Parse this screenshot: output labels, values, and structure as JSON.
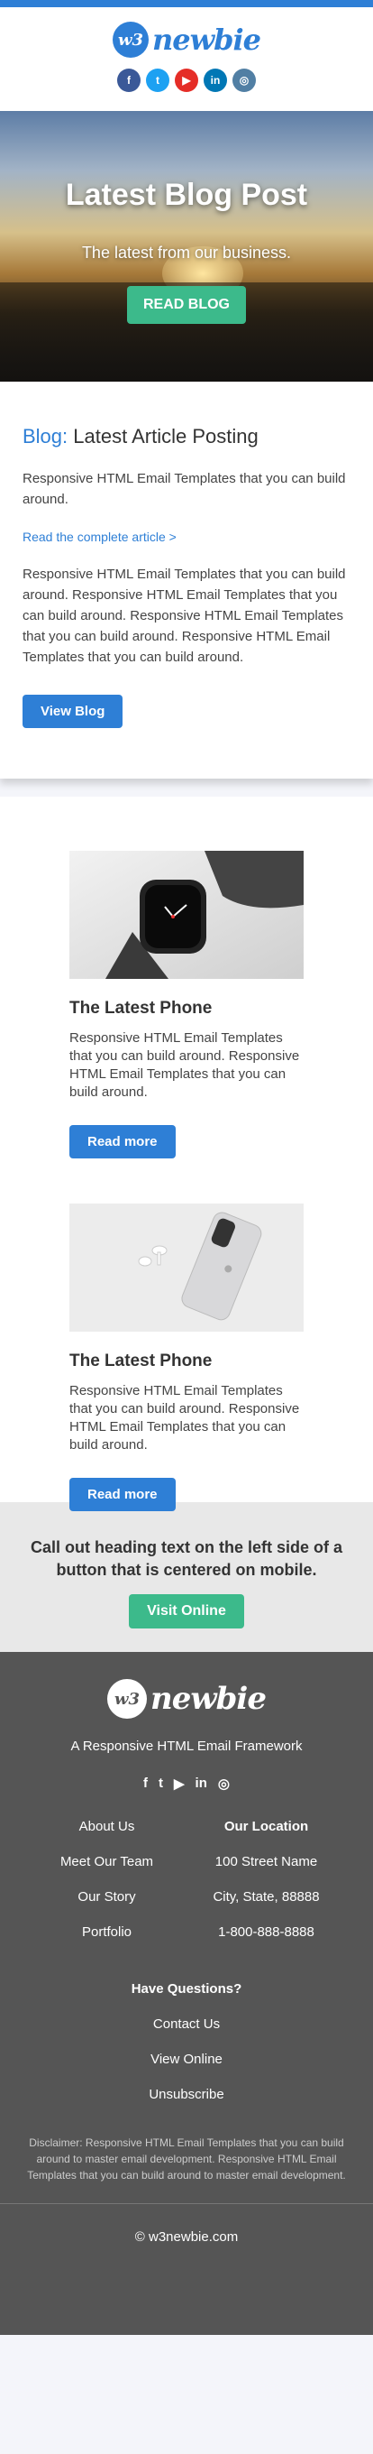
{
  "brand": {
    "badge": "w3",
    "name": "newbie"
  },
  "header_socials": [
    {
      "icon": "facebook-icon",
      "glyph": "f",
      "color": "#3b5998"
    },
    {
      "icon": "twitter-icon",
      "glyph": "t",
      "color": "#1da1f2"
    },
    {
      "icon": "youtube-icon",
      "glyph": "▶",
      "color": "#e52d27"
    },
    {
      "icon": "linkedin-icon",
      "glyph": "in",
      "color": "#0077b5"
    },
    {
      "icon": "instagram-icon",
      "glyph": "◎",
      "color": "#517fa4"
    }
  ],
  "hero": {
    "title": "Latest Blog Post",
    "subtitle": "The latest from our business.",
    "button": "READ BLOG"
  },
  "article": {
    "heading_prefix": "Blog:",
    "heading_rest": " Latest Article Posting",
    "intro": "Responsive HTML Email Templates that you can build around.",
    "link": "Read the complete article >",
    "body": "Responsive HTML Email Templates that you can build around. Responsive HTML Email Templates that you can build around. Responsive HTML Email Templates that you can build around. Responsive HTML Email Templates that you can build around.",
    "button": "View Blog"
  },
  "products": [
    {
      "title": "The Latest Phone",
      "text": "Responsive HTML Email Templates that you can build around. Responsive HTML Email Templates that you can build around.",
      "button": "Read more"
    },
    {
      "title": "The Latest Phone",
      "text": "Responsive HTML Email Templates that you can build around. Responsive HTML Email Templates that you can build around.",
      "button": "Read more"
    }
  ],
  "callout": {
    "heading": "Call out heading text on the left side of a button that is centered on mobile.",
    "button": "Visit Online"
  },
  "footer": {
    "tagline": "A Responsive HTML Email Framework",
    "socials": [
      {
        "icon": "facebook-icon",
        "glyph": "f"
      },
      {
        "icon": "twitter-icon",
        "glyph": "t"
      },
      {
        "icon": "youtube-icon",
        "glyph": "▶"
      },
      {
        "icon": "linkedin-icon",
        "glyph": "in"
      },
      {
        "icon": "instagram-icon",
        "glyph": "◎"
      }
    ],
    "links": [
      "About Us",
      "Meet Our Team",
      "Our Story",
      "Portfolio"
    ],
    "location": {
      "heading": "Our Location",
      "lines": [
        "100 Street Name",
        "City, State, 88888",
        "1-800-888-8888"
      ]
    },
    "questions": {
      "heading": "Have Questions?",
      "links": [
        "Contact Us",
        "View Online",
        "Unsubscribe"
      ]
    },
    "disclaimer": "Disclaimer: Responsive HTML Email Templates that you can build around to master email development. Responsive HTML Email Templates that you can build around to master email development.",
    "copyright": "© w3newbie.com"
  }
}
